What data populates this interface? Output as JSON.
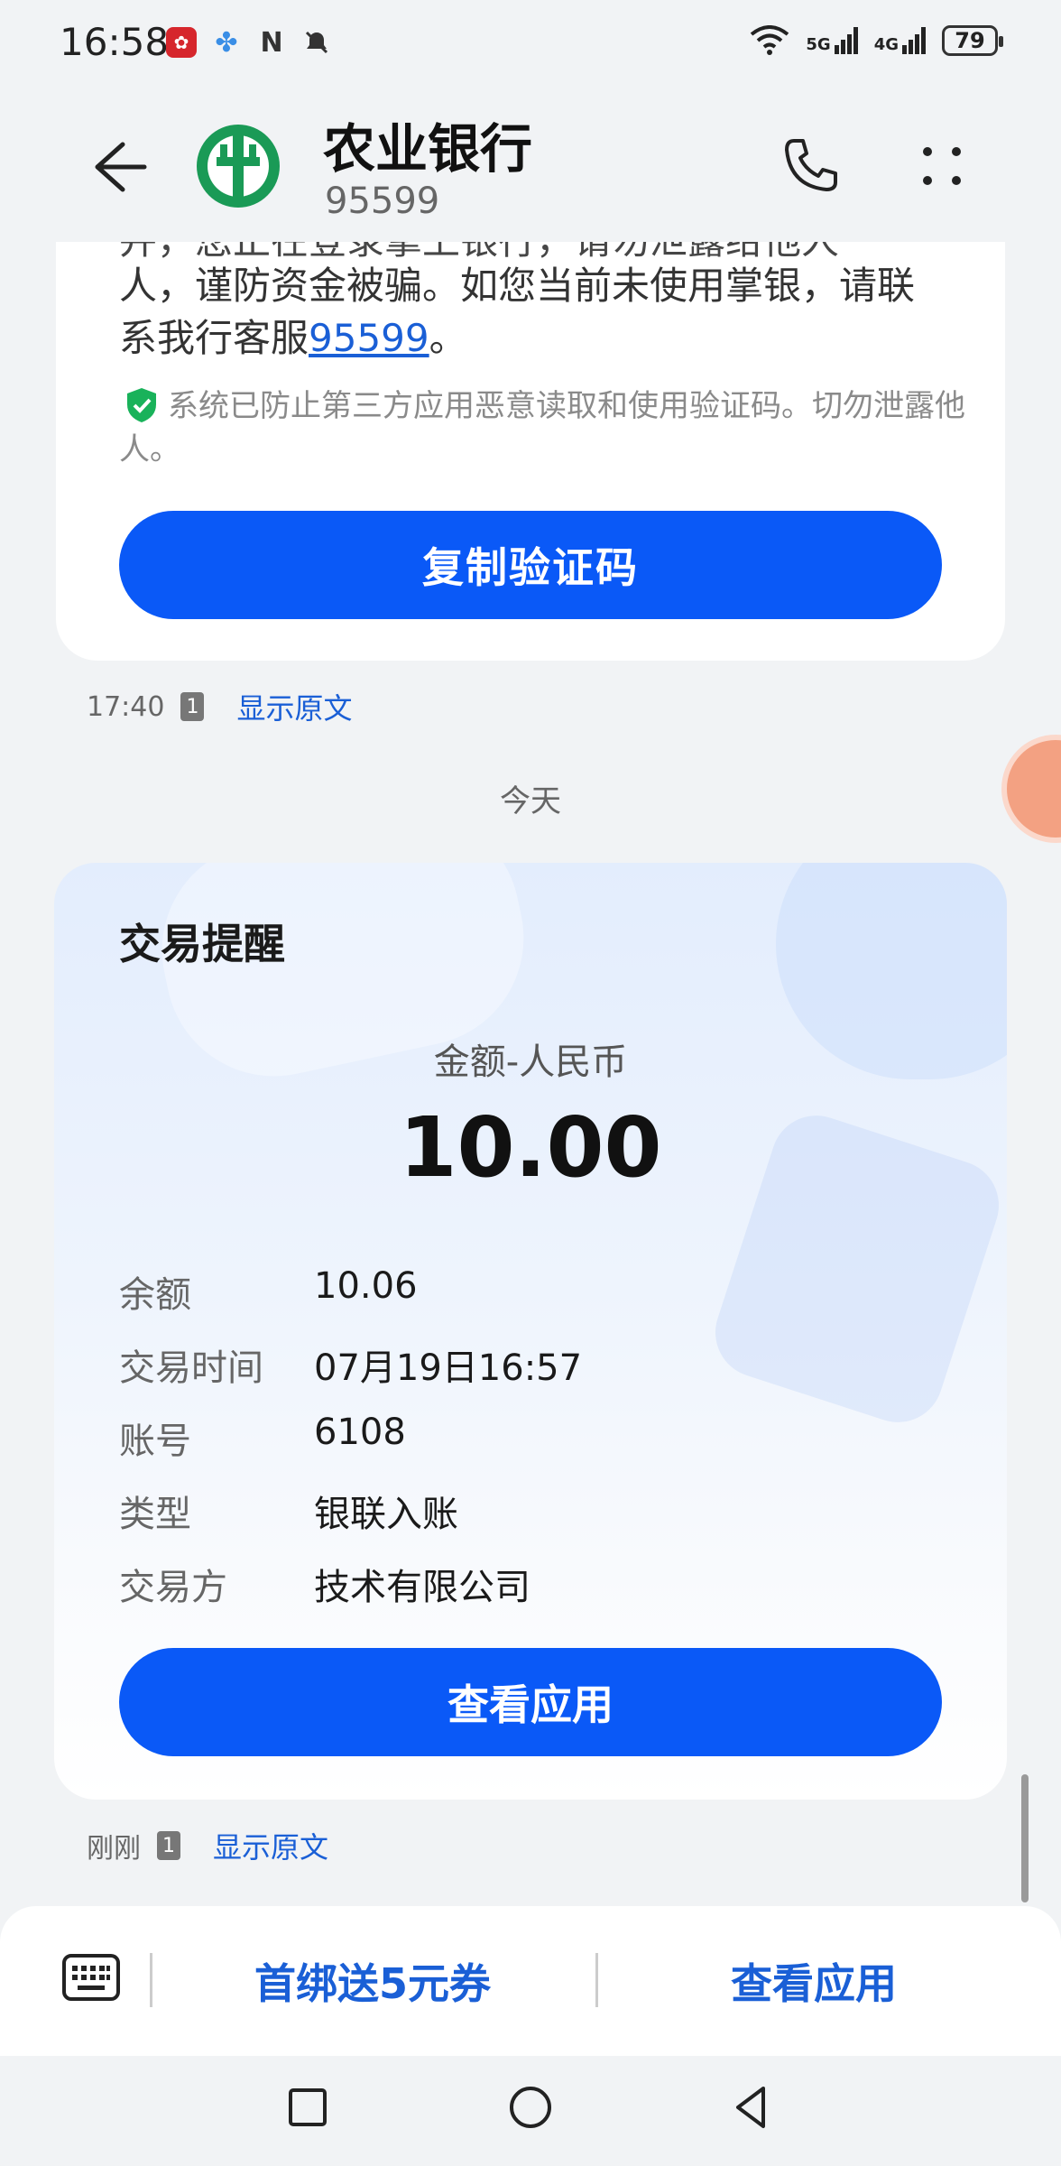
{
  "status_bar": {
    "time": "16:58",
    "battery": "79",
    "net1": "5G",
    "net2": "4G"
  },
  "header": {
    "title": "农业银行",
    "subtitle": "95599"
  },
  "message1": {
    "partial_line": "并，您正在登录掌上银行，请勿泄露给他人",
    "line_a": "人，谨防资金被骗。如您当前未使用掌银，请联",
    "line_b_prefix": "系我行客服",
    "line_b_link": "95599",
    "line_b_suffix": "。",
    "security_note": "系统已防止第三方应用恶意读取和使用验证码。切勿泄露他人。",
    "copy_button": "复制验证码",
    "time": "17:40",
    "sim": "1",
    "show_original": "显示原文"
  },
  "date_separator": "今天",
  "transaction": {
    "title": "交易提醒",
    "amount_label": "金额-人民币",
    "amount": "10.00",
    "rows": [
      {
        "key": "余额",
        "value": "10.06"
      },
      {
        "key": "交易时间",
        "value": "07月19日16:57"
      },
      {
        "key": "账号",
        "value": "6108"
      },
      {
        "key": "类型",
        "value": "银联入账"
      },
      {
        "key": "交易方",
        "value": "技术有限公司"
      }
    ],
    "view_button": "查看应用",
    "time": "刚刚",
    "sim": "1",
    "show_original": "显示原文"
  },
  "action_bar": {
    "action1": "首绑送5元券",
    "action2": "查看应用"
  },
  "colors": {
    "accent": "#0a59f7",
    "link": "#1a5fd6"
  }
}
